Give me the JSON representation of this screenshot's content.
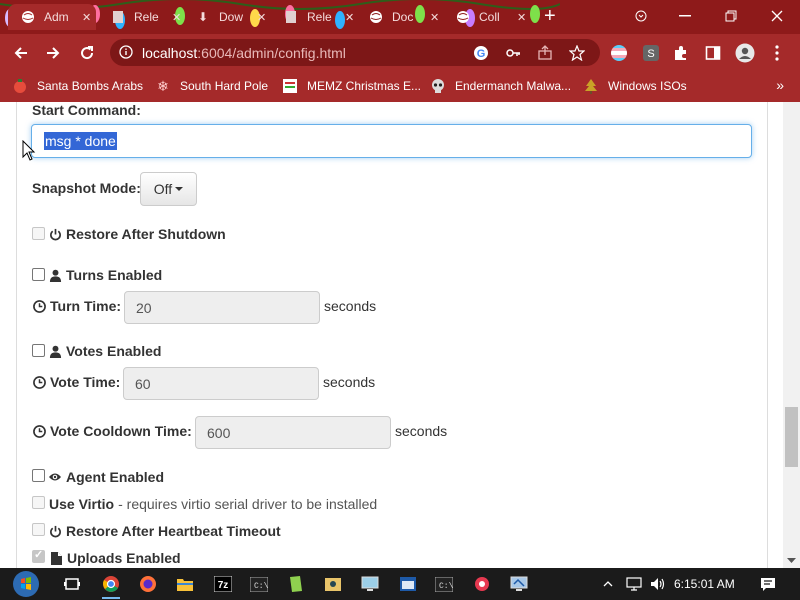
{
  "browser": {
    "tabs": [
      {
        "title": "Adm",
        "icon": "globe-icon"
      },
      {
        "title": "Rele",
        "icon": "page-icon"
      },
      {
        "title": "Dow",
        "icon": "download-icon"
      },
      {
        "title": "Rele",
        "icon": "page-icon"
      },
      {
        "title": "Doc",
        "icon": "globe-icon"
      },
      {
        "title": "Coll",
        "icon": "globe-icon"
      }
    ],
    "address": {
      "host": "localhost",
      "rest": ":6004/admin/config.html"
    },
    "bookmarks": [
      {
        "label": "Santa Bombs Arabs",
        "icon": "christmas-icon"
      },
      {
        "label": "South Hard Pole",
        "icon": "snowflake-icon"
      },
      {
        "label": "MEMZ Christmas E...",
        "icon": "page-icon"
      },
      {
        "label": "Endermanch Malwa...",
        "icon": "skull-icon"
      },
      {
        "label": "Windows ISOs",
        "icon": "tree-icon"
      }
    ],
    "bookmarks_more": "»"
  },
  "page": {
    "start_command": {
      "label": "Start Command:",
      "value": "msg * done"
    },
    "snapshot_mode": {
      "label": "Snapshot Mode:",
      "value": "Off"
    },
    "restore_after_shutdown": {
      "label": "Restore After Shutdown"
    },
    "turns_enabled": {
      "label": "Turns Enabled"
    },
    "turn_time": {
      "label": "Turn Time:",
      "value": "20",
      "unit": "seconds"
    },
    "votes_enabled": {
      "label": "Votes Enabled"
    },
    "vote_time": {
      "label": "Vote Time:",
      "value": "60",
      "unit": "seconds"
    },
    "vote_cooldown": {
      "label": "Vote Cooldown Time:",
      "value": "600",
      "unit": "seconds"
    },
    "agent_enabled": {
      "label": "Agent Enabled"
    },
    "use_virtio": {
      "label": "Use Virtio",
      "note": " - requires virtio serial driver to be installed"
    },
    "restore_heartbeat": {
      "label": "Restore After Heartbeat Timeout"
    },
    "uploads_enabled": {
      "label": "Uploads Enabled"
    }
  },
  "taskbar": {
    "time": "6:15:01 AM"
  }
}
